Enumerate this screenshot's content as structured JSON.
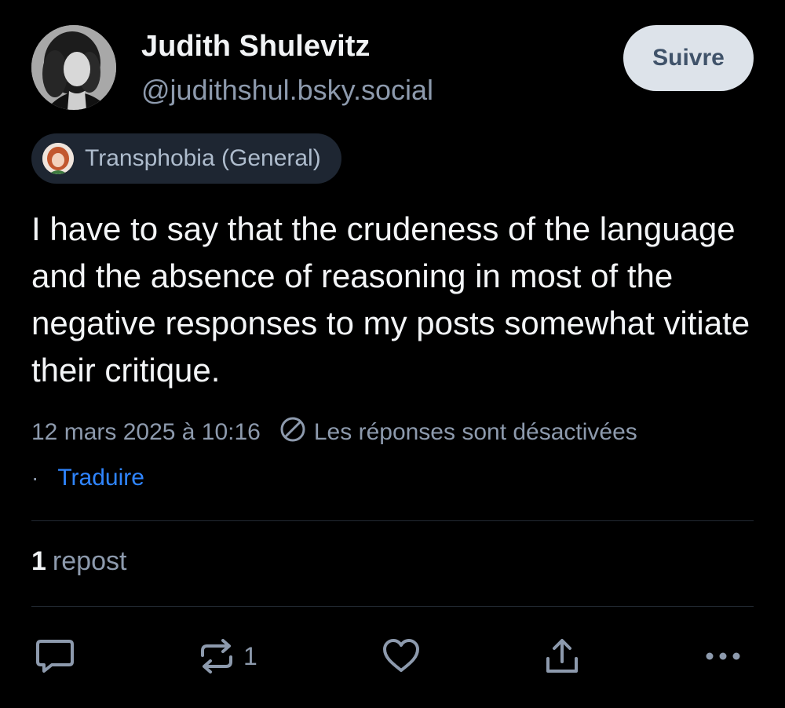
{
  "author": {
    "display_name": "Judith Shulevitz",
    "handle": "@judithshul.bsky.social",
    "avatar_icon": "author-avatar"
  },
  "follow_button": {
    "label": "Suivre"
  },
  "label": {
    "text": "Transphobia (General)",
    "icon": "labeler-avatar"
  },
  "post": {
    "text": "I have to say that the crudeness of the language and the absence of reasoning in most of the negative responses to my posts somewhat vitiate their critique."
  },
  "meta": {
    "timestamp": "12 mars 2025 à 10:16",
    "replies_disabled": "Les réponses sont désactivées",
    "separator": "·",
    "translate": "Traduire"
  },
  "stats": {
    "repost_count": "1",
    "repost_label": "repost"
  },
  "actions": {
    "reply_icon": "reply-icon",
    "repost_icon": "repost-icon",
    "repost_count": "1",
    "like_icon": "heart-icon",
    "share_icon": "share-icon",
    "more_icon": "more-icon"
  },
  "colors": {
    "background": "#000000",
    "text_primary": "#f1f3f5",
    "text_secondary": "#8d9aad",
    "link": "#2f85ff",
    "follow_bg": "#dde3ea",
    "pill_bg": "#1e2632"
  }
}
